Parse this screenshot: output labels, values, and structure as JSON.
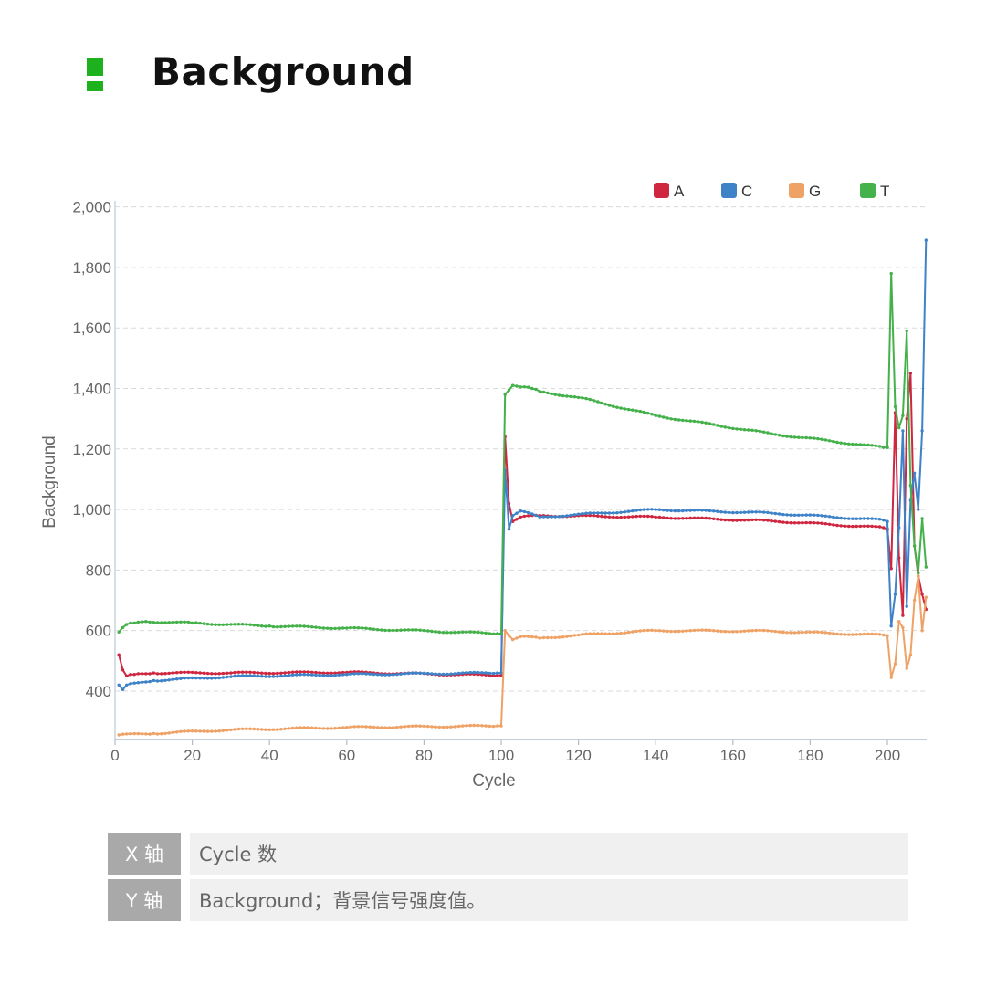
{
  "header": {
    "title": "Background",
    "accent_color": "#1db21d"
  },
  "chart_data": {
    "type": "line",
    "title": "",
    "xlabel": "Cycle",
    "ylabel": "Background",
    "xlim": [
      0,
      210
    ],
    "ylim": [
      240,
      2020
    ],
    "xticks": [
      0,
      20,
      40,
      60,
      80,
      100,
      120,
      140,
      160,
      180,
      200
    ],
    "yticks": [
      400,
      600,
      800,
      1000,
      1200,
      1400,
      1600,
      1800,
      2000
    ],
    "ytick_labels": [
      "400",
      "600",
      "800",
      "1,000",
      "1,200",
      "1,400",
      "1,600",
      "1,800",
      "2,000"
    ],
    "grid": "horizontal dashed",
    "legend_position": "top-right",
    "series": [
      {
        "name": "A",
        "color": "#cf2740",
        "segments": [
          [
            [
              1,
              520
            ],
            [
              2,
              470
            ],
            [
              3,
              450
            ],
            [
              5,
              455
            ],
            [
              10,
              460
            ],
            [
              30,
              460
            ],
            [
              60,
              462
            ],
            [
              99,
              452
            ],
            [
              100,
              452
            ]
          ],
          [
            [
              101,
              1240
            ],
            [
              102,
              1020
            ],
            [
              103,
              960
            ],
            [
              105,
              975
            ],
            [
              110,
              980
            ],
            [
              140,
              975
            ],
            [
              170,
              962
            ],
            [
              199,
              940
            ],
            [
              200,
              935
            ]
          ]
        ],
        "tail": [
          [
            200,
            935
          ],
          [
            201,
            805
          ],
          [
            202,
            1320
          ],
          [
            203,
            840
          ],
          [
            204,
            650
          ],
          [
            205,
            1300
          ],
          [
            206,
            1450
          ],
          [
            207,
            880
          ],
          [
            208,
            780
          ],
          [
            209,
            720
          ],
          [
            210,
            670
          ]
        ]
      },
      {
        "name": "C",
        "color": "#3e82c8",
        "segments": [
          [
            [
              1,
              420
            ],
            [
              2,
              405
            ],
            [
              3,
              420
            ],
            [
              10,
              435
            ],
            [
              30,
              448
            ],
            [
              60,
              455
            ],
            [
              99,
              460
            ],
            [
              100,
              460
            ]
          ],
          [
            [
              101,
              1130
            ],
            [
              102,
              935
            ],
            [
              103,
              980
            ],
            [
              105,
              995
            ],
            [
              110,
              975
            ],
            [
              140,
              1000
            ],
            [
              170,
              988
            ],
            [
              199,
              965
            ],
            [
              200,
              960
            ]
          ]
        ],
        "tail": [
          [
            200,
            960
          ],
          [
            201,
            615
          ],
          [
            202,
            720
          ],
          [
            203,
            940
          ],
          [
            204,
            1260
          ],
          [
            205,
            680
          ],
          [
            206,
            1030
          ],
          [
            207,
            1120
          ],
          [
            208,
            1000
          ],
          [
            209,
            1260
          ],
          [
            210,
            1890
          ]
        ]
      },
      {
        "name": "G",
        "color": "#efa266",
        "segments": [
          [
            [
              1,
              255
            ],
            [
              10,
              260
            ],
            [
              30,
              272
            ],
            [
              60,
              280
            ],
            [
              99,
              285
            ],
            [
              100,
              285
            ]
          ],
          [
            [
              101,
              600
            ],
            [
              103,
              570
            ],
            [
              105,
              580
            ],
            [
              110,
              575
            ],
            [
              120,
              585
            ],
            [
              140,
              600
            ],
            [
              170,
              598
            ],
            [
              199,
              585
            ],
            [
              200,
              583
            ]
          ]
        ],
        "tail": [
          [
            200,
            583
          ],
          [
            201,
            445
          ],
          [
            202,
            490
          ],
          [
            203,
            630
          ],
          [
            204,
            610
          ],
          [
            205,
            475
          ],
          [
            206,
            520
          ],
          [
            207,
            700
          ],
          [
            208,
            780
          ],
          [
            209,
            600
          ],
          [
            210,
            710
          ]
        ]
      },
      {
        "name": "T",
        "color": "#44b14a",
        "segments": [
          [
            [
              1,
              595
            ],
            [
              2,
              610
            ],
            [
              3,
              620
            ],
            [
              5,
              625
            ],
            [
              8,
              630
            ],
            [
              20,
              625
            ],
            [
              40,
              615
            ],
            [
              60,
              608
            ],
            [
              99,
              590
            ],
            [
              100,
              590
            ]
          ],
          [
            [
              101,
              1380
            ],
            [
              102,
              1395
            ],
            [
              103,
              1410
            ],
            [
              105,
              1405
            ],
            [
              108,
              1400
            ],
            [
              110,
              1390
            ],
            [
              120,
              1370
            ],
            [
              140,
              1310
            ],
            [
              170,
              1250
            ],
            [
              199,
              1205
            ],
            [
              200,
              1205
            ]
          ]
        ],
        "tail": [
          [
            200,
            1205
          ],
          [
            201,
            1780
          ],
          [
            202,
            1340
          ],
          [
            203,
            1270
          ],
          [
            204,
            1310
          ],
          [
            205,
            1590
          ],
          [
            206,
            1080
          ],
          [
            207,
            880
          ],
          [
            208,
            790
          ],
          [
            209,
            970
          ],
          [
            210,
            810
          ]
        ]
      }
    ]
  },
  "info_table": {
    "rows": [
      {
        "key": "X 轴",
        "value": "Cycle 数"
      },
      {
        "key": "Y 轴",
        "value": "Background；背景信号强度值。"
      }
    ]
  }
}
